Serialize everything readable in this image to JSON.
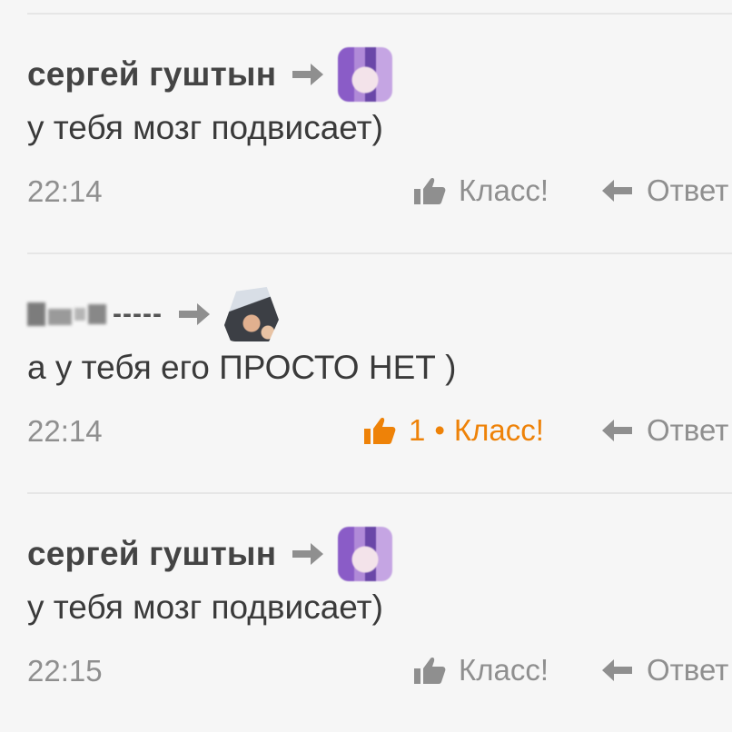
{
  "colors": {
    "background": "#f6f6f6",
    "text": "#3a3a3a",
    "muted": "#8f8f8f",
    "accent": "#ee8208",
    "divider": "#e6e6e6"
  },
  "comments": [
    {
      "author": "сергей гуштын",
      "author_blurred": false,
      "reply_to_icon": "reply-to-arrow-icon",
      "avatar": "purple-blurred-avatar",
      "text": "у тебя мозг подвисает)",
      "time": "22:14",
      "like": {
        "count": "",
        "separator": "",
        "label": "Класс!",
        "active": false,
        "icon": "thumbs-up-icon"
      },
      "reply_label": "Ответ",
      "reply_icon": "reply-arrow-icon"
    },
    {
      "author": "",
      "author_blurred": true,
      "author_tail": "-----",
      "reply_to_icon": "reply-to-arrow-icon",
      "avatar": "photo-avatar",
      "text": "а у тебя его ПРОСТО НЕТ )",
      "time": "22:14",
      "like": {
        "count": "1",
        "separator": "•",
        "label": "Класс!",
        "active": true,
        "icon": "thumbs-up-icon"
      },
      "reply_label": "Ответ",
      "reply_icon": "reply-arrow-icon"
    },
    {
      "author": "сергей гуштын",
      "author_blurred": false,
      "reply_to_icon": "reply-to-arrow-icon",
      "avatar": "purple-blurred-avatar",
      "text": "у тебя мозг подвисает)",
      "time": "22:15",
      "like": {
        "count": "",
        "separator": "",
        "label": "Класс!",
        "active": false,
        "icon": "thumbs-up-icon"
      },
      "reply_label": "Ответ",
      "reply_icon": "reply-arrow-icon"
    }
  ]
}
